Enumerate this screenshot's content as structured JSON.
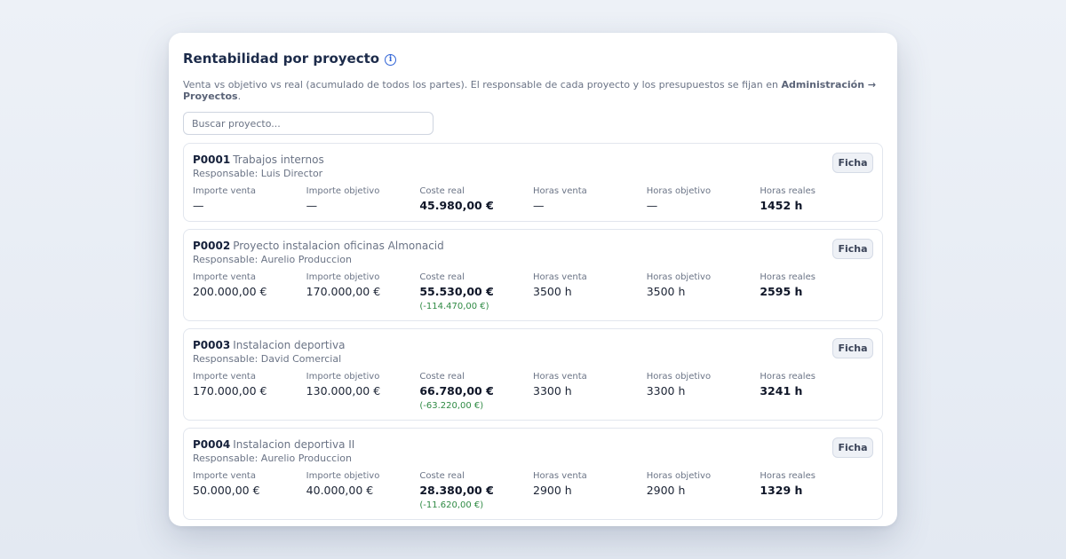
{
  "header": {
    "title": "Rentabilidad por proyecto",
    "info_icon": "info-icon",
    "subtitle_pre": "Venta vs objetivo vs real (acumulado de todos los partes). El responsable de cada proyecto y los presupuestos se fijan en ",
    "subtitle_bold": "Administración → Proyectos",
    "subtitle_post": "."
  },
  "search": {
    "placeholder": "Buscar proyecto...",
    "value": ""
  },
  "labels": {
    "importe_venta": "Importe venta",
    "importe_objetivo": "Importe objetivo",
    "coste_real": "Coste real",
    "horas_venta": "Horas venta",
    "horas_objetivo": "Horas objetivo",
    "horas_reales": "Horas reales",
    "ficha": "Ficha"
  },
  "colors": {
    "positive_diff": "#2f8a44",
    "accent": "#2f63d6"
  },
  "projects": [
    {
      "code": "P0001",
      "name": "Trabajos internos",
      "responsable": "Responsable: Luis Director",
      "importe_venta": "—",
      "importe_objetivo": "—",
      "coste_real": "45.980,00 €",
      "coste_diff": "",
      "horas_venta": "—",
      "horas_objetivo": "—",
      "horas_reales": "1452 h"
    },
    {
      "code": "P0002",
      "name": "Proyecto instalacion oficinas Almonacid",
      "responsable": "Responsable: Aurelio Produccion",
      "importe_venta": "200.000,00 €",
      "importe_objetivo": "170.000,00 €",
      "coste_real": "55.530,00 €",
      "coste_diff": "(-114.470,00 €)",
      "horas_venta": "3500 h",
      "horas_objetivo": "3500 h",
      "horas_reales": "2595 h"
    },
    {
      "code": "P0003",
      "name": "Instalacion deportiva",
      "responsable": "Responsable: David Comercial",
      "importe_venta": "170.000,00 €",
      "importe_objetivo": "130.000,00 €",
      "coste_real": "66.780,00 €",
      "coste_diff": "(-63.220,00 €)",
      "horas_venta": "3300 h",
      "horas_objetivo": "3300 h",
      "horas_reales": "3241 h"
    },
    {
      "code": "P0004",
      "name": "Instalacion deportiva II",
      "responsable": "Responsable: Aurelio Produccion",
      "importe_venta": "50.000,00 €",
      "importe_objetivo": "40.000,00 €",
      "coste_real": "28.380,00 €",
      "coste_diff": "(-11.620,00 €)",
      "horas_venta": "2900 h",
      "horas_objetivo": "2900 h",
      "horas_reales": "1329 h"
    }
  ]
}
